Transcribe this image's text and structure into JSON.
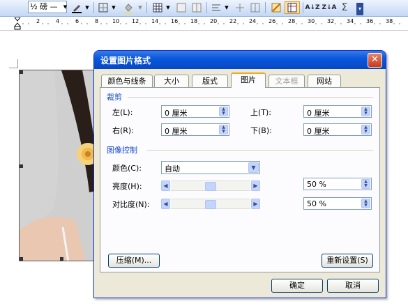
{
  "toolbar": {
    "line_weight_value": "½ 磅",
    "line_style_value": "—"
  },
  "ruler": {
    "numbers": [
      "2",
      "4",
      "6",
      "8",
      "10",
      "12",
      "14",
      "16",
      "18",
      "20",
      "22",
      "24",
      "26",
      "28",
      "30",
      "32",
      "34",
      "36",
      "38"
    ]
  },
  "dialog": {
    "title": "设置图片格式",
    "close_glyph": "✕",
    "tabs": [
      {
        "label": "颜色与线条"
      },
      {
        "label": "大小"
      },
      {
        "label": "版式"
      },
      {
        "label": "图片",
        "active": true
      },
      {
        "label": "文本框",
        "disabled": true
      },
      {
        "label": "网站"
      }
    ],
    "crop": {
      "group_label": "裁剪",
      "left_label": "左(L):",
      "left_value": "0 厘米",
      "top_label": "上(T):",
      "top_value": "0 厘米",
      "right_label": "右(R):",
      "right_value": "0 厘米",
      "bottom_label": "下(B):",
      "bottom_value": "0 厘米"
    },
    "image_control": {
      "group_label": "图像控制",
      "color_label": "颜色(C):",
      "color_value": "自动",
      "brightness_label": "亮度(H):",
      "brightness_value": "50 %",
      "brightness_level": 0.5,
      "contrast_label": "对比度(N):",
      "contrast_value": "50 %",
      "contrast_level": 0.5
    },
    "compress_button": "压缩(M)...",
    "reset_button": "重新设置(S)",
    "ok_button": "确定",
    "cancel_button": "取消"
  }
}
